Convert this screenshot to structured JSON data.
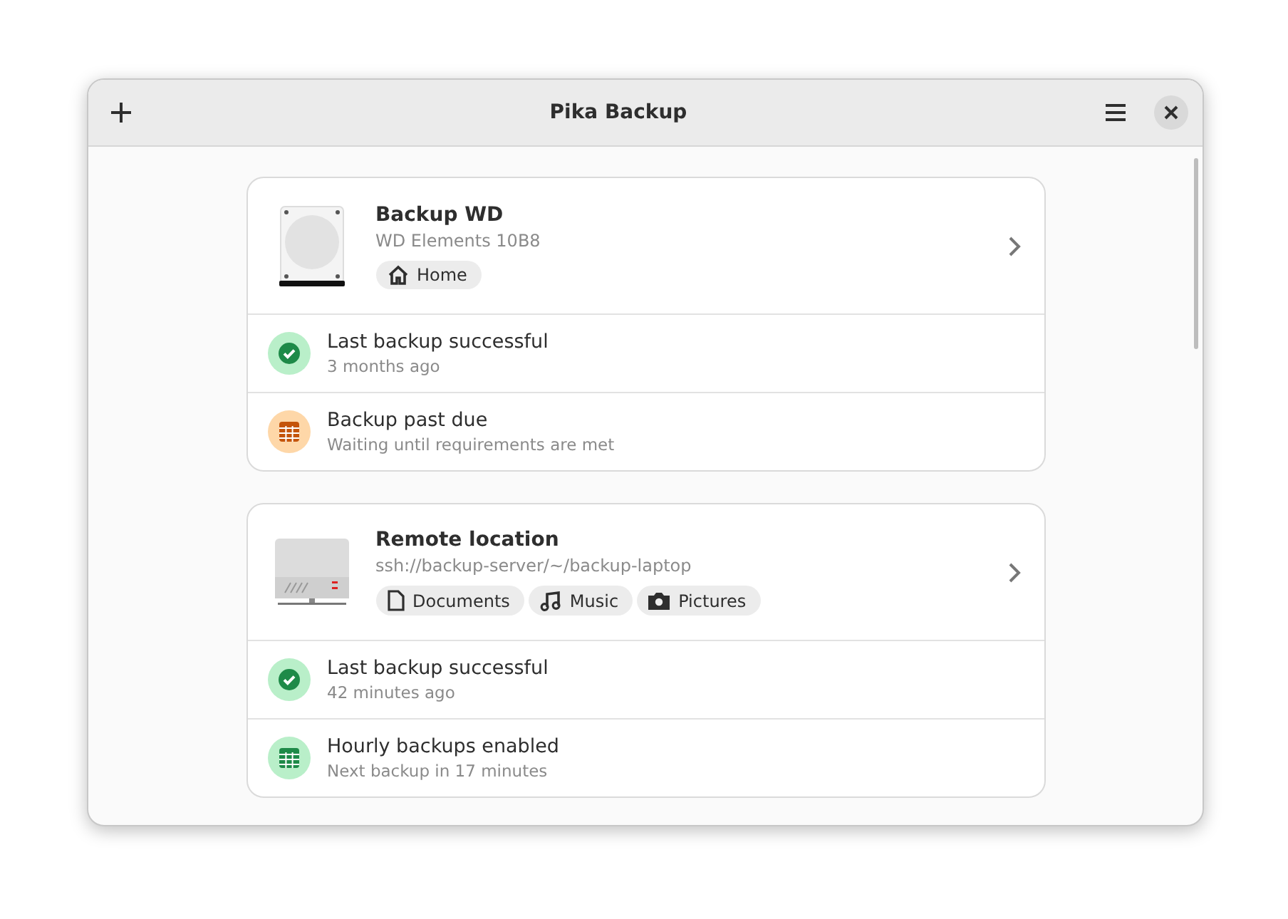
{
  "window": {
    "title": "Pika Backup"
  },
  "backups": [
    {
      "kind": "disk",
      "title": "Backup WD",
      "subtitle": "WD Elements 10B8",
      "includes": [
        {
          "kind": "home",
          "label": "Home"
        }
      ],
      "status": [
        {
          "kind": "success",
          "title": "Last backup successful",
          "subtitle": "3 months ago"
        },
        {
          "kind": "overdue",
          "title": "Backup past due",
          "subtitle": "Waiting until requirements are met"
        }
      ]
    },
    {
      "kind": "remote",
      "title": "Remote location",
      "subtitle": "ssh://backup-server/~/backup-laptop",
      "includes": [
        {
          "kind": "documents",
          "label": "Documents"
        },
        {
          "kind": "music",
          "label": "Music"
        },
        {
          "kind": "pictures",
          "label": "Pictures"
        }
      ],
      "status": [
        {
          "kind": "success",
          "title": "Last backup successful",
          "subtitle": "42 minutes ago"
        },
        {
          "kind": "scheduled",
          "title": "Hourly backups enabled",
          "subtitle": "Next backup in 17 minutes"
        }
      ]
    }
  ]
}
